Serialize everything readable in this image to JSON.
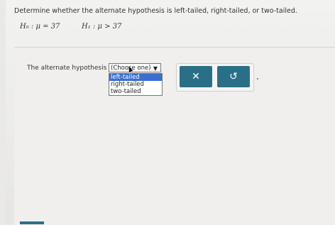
{
  "question": "Determine whether the alternate hypothesis is left-tailed, right-tailed, or two-tailed.",
  "h0": "H₀ : μ = 37",
  "h1": "H₁ : μ > 37",
  "answer_label": "The alternate hypothesis is",
  "dropdown": {
    "selected": "(Choose one)",
    "options": [
      "left-tailed",
      "right-tailed",
      "two-tailed"
    ]
  },
  "buttons": {
    "clear": "✕",
    "reset": "↺"
  }
}
